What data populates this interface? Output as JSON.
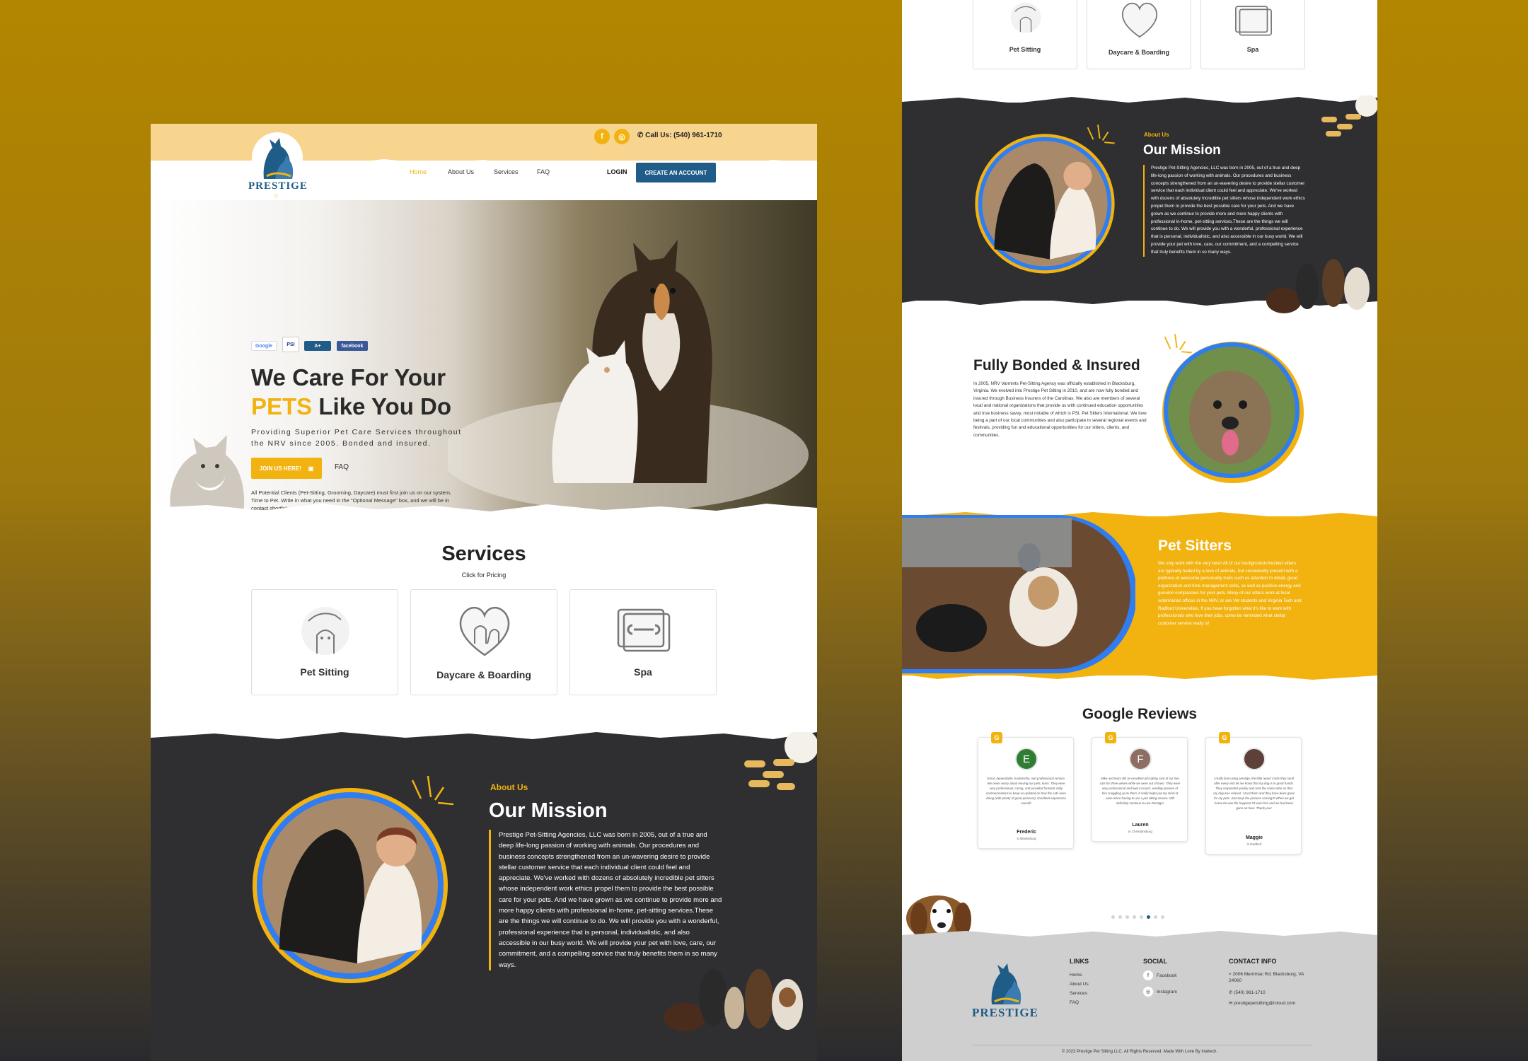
{
  "header": {
    "phone": "Call Us: (540) 961-1710",
    "logo_text": "PRESTIGE",
    "nav": [
      "Home",
      "About Us",
      "Services",
      "FAQ"
    ],
    "login": "LOGIN",
    "create_account": "CREATE AN ACCOUNT"
  },
  "hero": {
    "badges": [
      "Google",
      "PSI",
      "A+",
      "facebook"
    ],
    "title_line1": "We Care For Your",
    "title_highlight": "PETS",
    "title_line2_rest": " Like You Do",
    "subtitle": "Providing Superior Pet Care Services throughout the NRV since 2005. Bonded and insured.",
    "join_button": "JOIN US HERE!",
    "faq_link": "FAQ",
    "note": "All Potential Clients (Pet-Sitting, Grooming, Daycare) must first join us on our system, Time to Pet. Write in what you need in the \"Optional Message\" box, and we will be in contact shortly!"
  },
  "services": {
    "title": "Services",
    "subtitle": "Click for Pricing",
    "items": [
      "Pet Sitting",
      "Daycare & Boarding",
      "Spa"
    ]
  },
  "mission": {
    "tag": "About Us",
    "title": "Our Mission",
    "text": "Prestige Pet-Sitting Agencies, LLC was born in 2005, out of a true and deep life-long passion of working with animals. Our procedures and business concepts strengthened from an un-wavering desire to provide stellar customer service that each individual client could feel and appreciate. We've worked with dozens of absolutely incredible pet sitters whose independent work ethics propel them to provide the best possible care for your pets. And we have grown as we continue to provide more and more happy clients with professional in-home, pet-sitting services.These are the things we will continue to do. We will provide you with a wonderful, professional experience that is personal, individualistic, and also accessible in our busy world. We will provide your pet with love, care, our commitment, and a compelling service that truly benefits them in so many ways."
  },
  "bonded": {
    "title": "Fully Bonded & Insured",
    "text": "In 2005, NRV Varmints Pet-Sitting Agency was officially established in Blacksburg, Virginia. We evolved into Prestige Pet Sitting in 2010, and are now fully bonded and insured through Business Insurers of the Carolinas. We also are members of several local and national organizations that provide us with continued education opportunities and true business savvy, most notable of which is PSI, Pet Sitters International. We love being a part of our local communities and also participate in several regional events and festivals, providing fun and educational opportunities for our sitters, clients, and communities."
  },
  "pet_sitters": {
    "title": "Pet Sitters",
    "text": "We only work with the very best! All of our background-checked sitters are typically fueled by a love of animals, but consistently present with a plethora of awesome personality traits such as attention to detail, great organization and time management skills, as well as positive energy and genuine compassion for your pets. Many of our sitters work at local veterinarian offices in the NRV, or are Vet students and Virginia Tech and Radford Universities. If you have forgotten what it's like to work with professionals who love their jobs, come be reminded what stellar customer service really is!"
  },
  "reviews": {
    "title": "Google Reviews",
    "items": [
      {
        "initial": "E",
        "color": "#2e7d32",
        "name": "Frederic",
        "location": "in Blacksburg",
        "text": "Great, dependable, trustworthy, and professional service. We never worry about leaving our pets, team. They were very professional, caring, and provided fantastic daily communications to keep us updated on how the cats were doing (with plenty of great pictures!). Excellent experience overall!"
      },
      {
        "initial": "F",
        "color": "#8d6e63",
        "name": "Lauren",
        "location": "in Christiansburg",
        "text": "Mike and team did an excellent job taking care of our two cats for three weeks while we were out of town. They were very professional and kept in touch, sending pictures of him snuggling up to them. It really helps put my mind at ease when having to use a pet sitting service. Will definitely continue to use Prestige!"
      },
      {
        "initial": "",
        "color": "#5d4037",
        "name": "Maggie",
        "location": "in Radford",
        "text": "I really love using prestige, the little report cards they send after every visit let me know that my dog is in great hands. They responded quickly and sent the same sitter so that my dog was relaxed. I trust them and they have been great for my pets. Just keep the pictures coming!!! When we get home he was the happiest I'd seen him and we had been gone an hour. Thank you!"
      }
    ]
  },
  "footer": {
    "logo_text": "PRESTIGE",
    "links_title": "LINKS",
    "links": [
      "Home",
      "About Us",
      "Services",
      "FAQ"
    ],
    "social_title": "SOCIAL",
    "social": [
      "Facebook",
      "Instagram"
    ],
    "contact_title": "CONTACT INFO",
    "address": "2006 Merrimac Rd, Blacksburg, VA 24060",
    "phone": "(540) 961-1710",
    "email": "prestigepetsitting@icloud.com",
    "copyright": "© 2023 Prestige Pet Sitting LLC. All Rights Reserved. Made With Love By Inaltech."
  },
  "colors": {
    "brand_yellow": "#f2b311",
    "brand_blue": "#1f5c87",
    "dark_bg": "#2f2f31",
    "ring_blue": "#2f7df0"
  },
  "carousel_dots": 8,
  "carousel_active": 6
}
